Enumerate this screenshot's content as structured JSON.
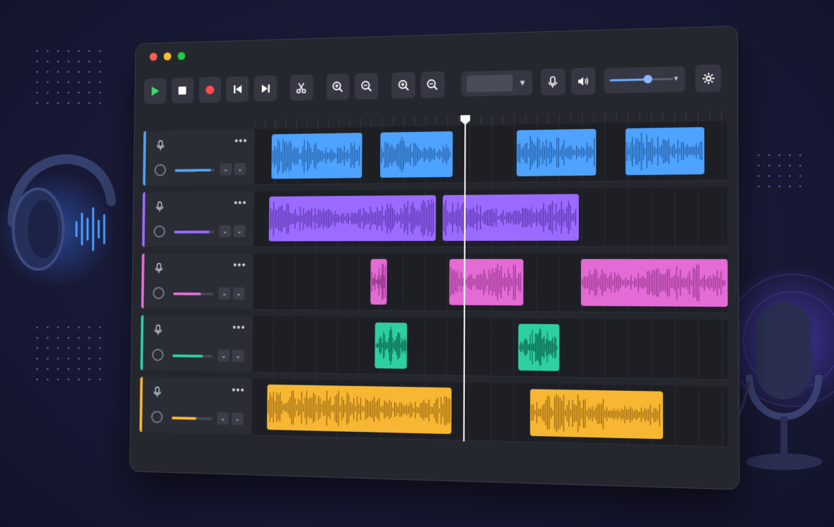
{
  "window": {
    "traffic_lights": [
      "#ff5f57",
      "#febc2e",
      "#28c840"
    ]
  },
  "toolbar": {
    "buttons": [
      {
        "name": "play-button",
        "icon": "play-icon",
        "color": "#3ddc6b"
      },
      {
        "name": "stop-button",
        "icon": "stop-icon",
        "color": "#ffffff"
      },
      {
        "name": "record-button",
        "icon": "record-icon",
        "color": "#ff4d4d"
      },
      {
        "name": "skip-back-button",
        "icon": "skip-back-icon",
        "color": "#ffffff"
      },
      {
        "name": "skip-forward-button",
        "icon": "skip-forward-icon",
        "color": "#ffffff"
      },
      {
        "name": "cut-button",
        "icon": "scissors-icon",
        "color": "#ffffff"
      },
      {
        "name": "zoom-in-button",
        "icon": "zoom-in-icon",
        "color": "#ffffff"
      },
      {
        "name": "zoom-out-button",
        "icon": "zoom-out-icon",
        "color": "#ffffff"
      },
      {
        "name": "zoom-fit-in-button",
        "icon": "zoom-in-icon",
        "color": "#ffffff"
      },
      {
        "name": "zoom-fit-out-button",
        "icon": "zoom-out-icon",
        "color": "#ffffff"
      }
    ],
    "dropdown": {
      "value": ""
    },
    "mic_icon": "microphone-icon",
    "volume_icon": "speaker-icon",
    "volume_level": 0.6,
    "settings_icon": "gear-icon"
  },
  "tracks": [
    {
      "color": "#4da3ff",
      "wave": "#1f4f8f",
      "volume": 0.9,
      "clips": [
        {
          "start": 0.04,
          "width": 0.2
        },
        {
          "start": 0.28,
          "width": 0.155
        },
        {
          "start": 0.57,
          "width": 0.165
        },
        {
          "start": 0.795,
          "width": 0.16
        }
      ]
    },
    {
      "color": "#9b6bff",
      "wave": "#4d2a99",
      "volume": 0.88,
      "clips": [
        {
          "start": 0.035,
          "width": 0.365
        },
        {
          "start": 0.415,
          "width": 0.285
        }
      ]
    },
    {
      "color": "#e46bd6",
      "wave": "#8a2f80",
      "volume": 0.7,
      "clips": [
        {
          "start": 0.26,
          "width": 0.035
        },
        {
          "start": 0.43,
          "width": 0.155
        },
        {
          "start": 0.705,
          "width": 0.295
        }
      ]
    },
    {
      "color": "#2ecfa3",
      "wave": "#0f6a50",
      "volume": 0.75,
      "clips": [
        {
          "start": 0.27,
          "width": 0.07
        },
        {
          "start": 0.575,
          "width": 0.085
        }
      ]
    },
    {
      "color": "#f7b733",
      "wave": "#8a5a0c",
      "volume": 0.62,
      "clips": [
        {
          "start": 0.035,
          "width": 0.4
        },
        {
          "start": 0.6,
          "width": 0.27
        }
      ]
    }
  ],
  "playhead_position": 0.46
}
